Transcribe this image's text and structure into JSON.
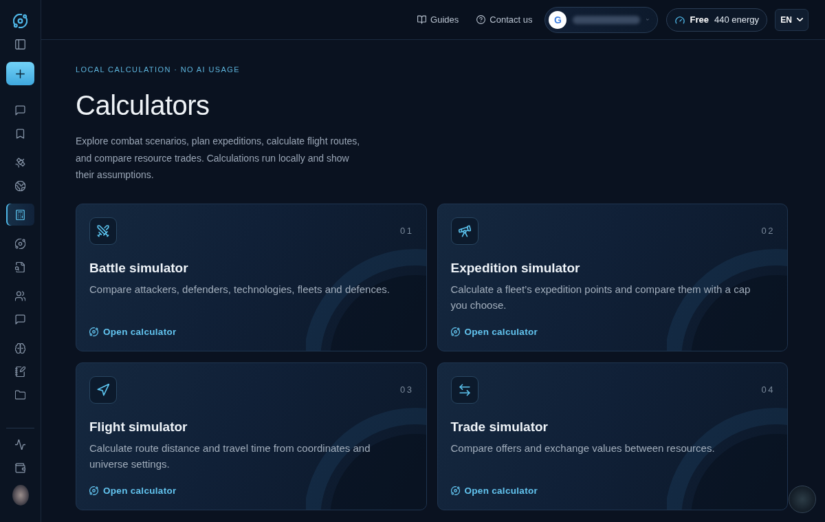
{
  "sidebar": {
    "nav_groups": [
      {
        "items": [
          {
            "selected": false
          },
          {
            "selected": false
          }
        ]
      },
      {
        "items": [
          {
            "selected": false
          },
          {
            "selected": false
          }
        ]
      },
      {
        "items": [
          {
            "selected": true
          }
        ]
      },
      {
        "items": [
          {
            "selected": false
          },
          {
            "selected": false
          }
        ]
      },
      {
        "items": [
          {
            "selected": false
          },
          {
            "selected": false
          }
        ]
      },
      {
        "items": [
          {
            "selected": false
          },
          {
            "selected": false
          },
          {
            "selected": false
          }
        ]
      }
    ],
    "footer_items": [
      {
        "selected": false
      },
      {
        "selected": false
      }
    ]
  },
  "top_bar": {
    "links": [
      {
        "label": "Guides"
      },
      {
        "label": "Contact us"
      }
    ],
    "account": {
      "initial": "G"
    },
    "plan": {
      "name": "Free",
      "energy": "440 energy"
    },
    "language": {
      "code": "EN"
    }
  },
  "header": {
    "eyebrow": "LOCAL CALCULATION · NO AI USAGE",
    "title": "Calculators",
    "description": "Explore combat scenarios, plan expeditions, calculate flight routes, and compare resource trades. Calculations run locally and show their assumptions."
  },
  "calculators": [
    {
      "number": "01",
      "title": "Battle simulator",
      "description": "Compare attackers, defenders, technologies, fleets and defences.",
      "link": "Open calculator"
    },
    {
      "number": "02",
      "title": "Expedition simulator",
      "description": "Calculate a fleet’s expedition points and compare them with a cap you choose.",
      "link": "Open calculator"
    },
    {
      "number": "03",
      "title": "Flight simulator",
      "description": "Calculate route distance and travel time from coordinates and universe settings.",
      "link": "Open calculator"
    },
    {
      "number": "04",
      "title": "Trade simulator",
      "description": "Compare offers and exchange values between resources.",
      "link": "Open calculator"
    }
  ]
}
